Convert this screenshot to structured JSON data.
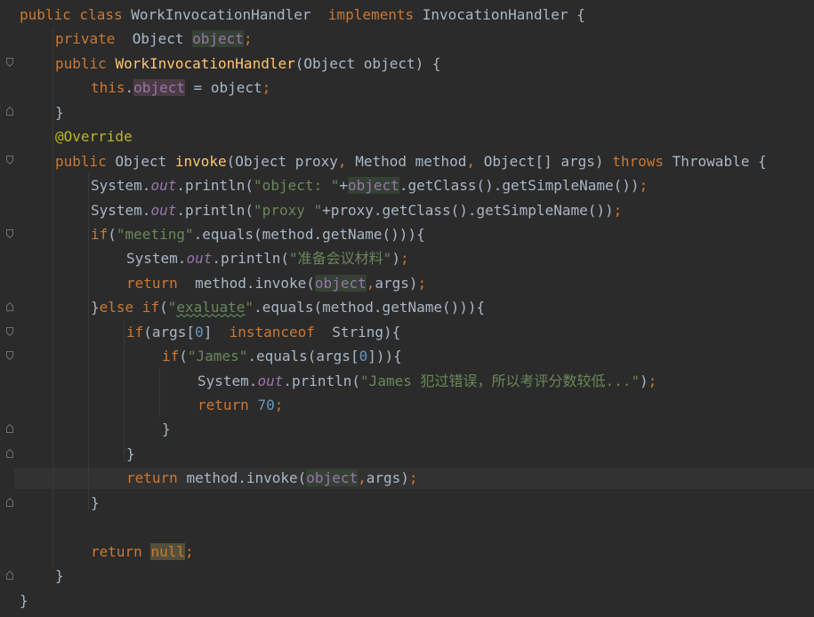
{
  "editor": {
    "language": "java",
    "theme_colors": {
      "background": "#2b2b2b",
      "text": "#a9b7c6",
      "keyword": "#cc7832",
      "field": "#9876aa",
      "method_decl": "#ffc66d",
      "string": "#6a8759",
      "number": "#6897bb",
      "annotation": "#bbb529"
    },
    "current_line": 20,
    "fold_markers": [
      "fold-open-icon",
      "fold-close-icon"
    ],
    "tokens": {
      "l1": [
        "public class",
        "WorkInvocationHandler",
        "implements",
        "InvocationHandler {"
      ],
      "l2": [
        "private",
        "Object",
        "object",
        ";"
      ],
      "l3": [
        "public",
        "WorkInvocationHandler",
        "(Object object) {"
      ],
      "l4": [
        "this",
        ".",
        "object",
        " = object",
        ";"
      ],
      "l5": [
        "}"
      ],
      "l6": [
        "@Override"
      ],
      "l7": [
        "public",
        "Object",
        "invoke",
        "(Object proxy",
        ",",
        "Method method",
        ",",
        "Object[] args)",
        "throws",
        "Throwable {"
      ],
      "l8": [
        "System.",
        "out",
        ".println(",
        "\"object: \"",
        "+",
        "object",
        ".getClass().getSimpleName())",
        ";"
      ],
      "l9": [
        "System.",
        "out",
        ".println(",
        "\"proxy \"",
        "+proxy.getClass().getSimpleName())",
        ";"
      ],
      "l10": [
        "if",
        "(",
        "\"meeting\"",
        ".equals(method.getName())){"
      ],
      "l11": [
        "System.",
        "out",
        ".println(",
        "\"准备会议材料\"",
        ")",
        ";"
      ],
      "l12": [
        "return",
        "method.invoke(",
        "object",
        ",",
        "args)",
        ";"
      ],
      "l13": [
        "}",
        "else if",
        "(",
        "\"",
        "exaluate",
        "\"",
        ".equals(method.getName())){"
      ],
      "l14": [
        "if",
        "(args[",
        "0",
        "]",
        "instanceof",
        "String){"
      ],
      "l15": [
        "if",
        "(",
        "\"James\"",
        ".equals(args[",
        "0",
        "])){"
      ],
      "l16": [
        "System.",
        "out",
        ".println(",
        "\"James 犯过错误，所以考评分数较低...\"",
        ")",
        ";"
      ],
      "l17": [
        "return",
        "70",
        ";"
      ],
      "l18": [
        "}"
      ],
      "l19": [
        "}"
      ],
      "l20": [
        "return",
        "method.invoke(",
        "object",
        ",",
        "args)",
        ";"
      ],
      "l21": [
        "}"
      ],
      "l22": [
        "return",
        "null",
        ";"
      ],
      "l23": [
        "}"
      ],
      "l24": [
        "}"
      ]
    }
  }
}
